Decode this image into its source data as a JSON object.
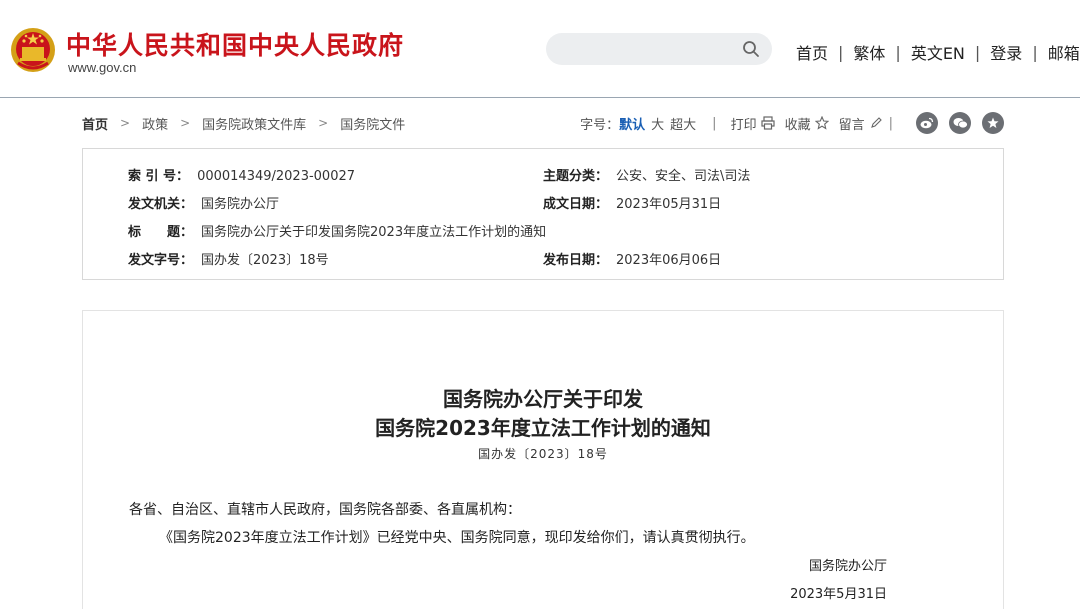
{
  "header": {
    "site_title": "中华人民共和国中央人民政府",
    "site_domain": "www.gov.cn",
    "search": {
      "placeholder": ""
    },
    "nav": [
      "首页",
      "繁体",
      "英文EN",
      "登录",
      "邮箱"
    ],
    "colors": {
      "brand_red": "#c9141b",
      "link_blue": "#1a5fb4"
    }
  },
  "breadcrumb": [
    "首页",
    "政策",
    "国务院政策文件库",
    "国务院文件"
  ],
  "tools": {
    "font_size_label": "字号：",
    "font_default": "默认",
    "font_large": "大",
    "font_xlarge": "超大",
    "print": "打印",
    "favorite": "收藏",
    "comment": "留言",
    "share_icons": [
      "weibo-icon",
      "wechat-icon",
      "star-icon"
    ]
  },
  "metadata": {
    "index_label": "索 引 号：",
    "index_value": "000014349/2023-00027",
    "topic_label": "主题分类：",
    "topic_value": "公安、安全、司法\\司法",
    "issuer_label": "发文机关：",
    "issuer_value": "国务院办公厅",
    "written_date_label": "成文日期：",
    "written_date_value": "2023年05月31日",
    "title_label": "标　　题：",
    "title_value": "国务院办公厅关于印发国务院2023年度立法工作计划的通知",
    "doc_no_label": "发文字号：",
    "doc_no_value": "国办发〔2023〕18号",
    "publish_date_label": "发布日期：",
    "publish_date_value": "2023年06月06日"
  },
  "document": {
    "title_line1": "国务院办公厅关于印发",
    "title_line2": "国务院2023年度立法工作计划的通知",
    "number": "国办发〔2023〕18号",
    "salutation": "各省、自治区、直辖市人民政府，国务院各部委、各直属机构：",
    "body": "《国务院2023年度立法工作计划》已经党中央、国务院同意，现印发给你们，请认真贯彻执行。",
    "signature": "国务院办公厅",
    "date": "2023年5月31日"
  }
}
